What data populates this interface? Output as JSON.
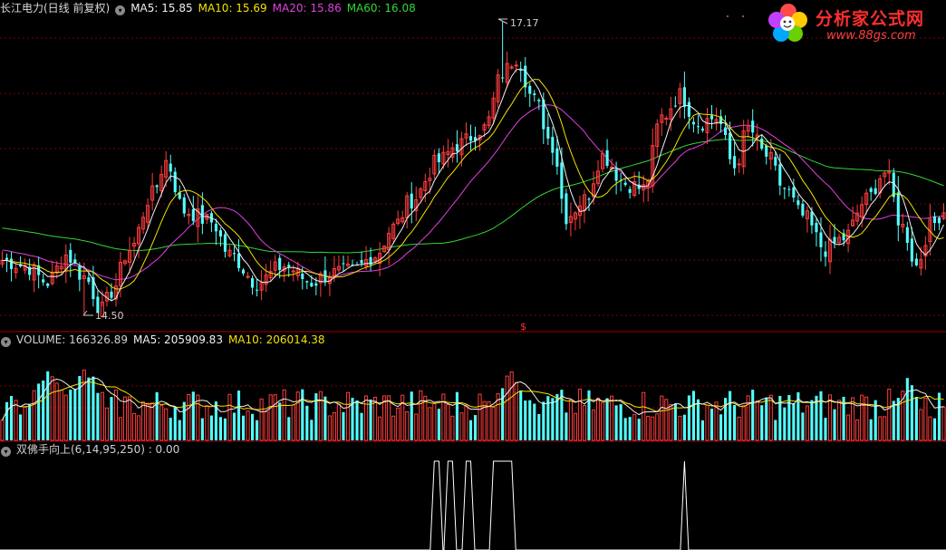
{
  "main": {
    "title": "长江电力(日线 前复权)",
    "ma": [
      {
        "label": "MA5: 15.85",
        "color": "#f0f0f0"
      },
      {
        "label": "MA10: 15.69",
        "color": "#f2e200"
      },
      {
        "label": "MA20: 15.86",
        "color": "#e040e0"
      },
      {
        "label": "MA60: 16.08",
        "color": "#33d633"
      }
    ],
    "high_label": "17.17",
    "low_label": "14.50",
    "marker": "$"
  },
  "volume": {
    "labels": [
      {
        "label": "VOLUME: 166326.89",
        "color": "#d0d0d0"
      },
      {
        "label": "MA5: 205909.83",
        "color": "#f0f0f0"
      },
      {
        "label": "MA10: 206014.38",
        "color": "#f2e200"
      }
    ]
  },
  "indicator": {
    "label": "双佛手向上(6,14,95,250) : 0.00",
    "color": "#d0d0d0"
  },
  "logo": {
    "text": "分析家公式网",
    "url": "www.88gs.com"
  },
  "colors": {
    "up": "#ff3d3d",
    "down": "#54ffff",
    "grid": "#7a0000",
    "separator": "#a00000"
  },
  "chart_data": {
    "type": "candlestick",
    "title": "长江电力(日线 前复权)",
    "price_range": [
      14.5,
      17.17
    ],
    "anchors": [
      {
        "i": 0,
        "c": 15.0
      },
      {
        "i": 5,
        "c": 14.95
      },
      {
        "i": 10,
        "c": 14.8
      },
      {
        "i": 14,
        "c": 15.05
      },
      {
        "i": 18,
        "c": 14.85
      },
      {
        "i": 22,
        "c": 14.55
      },
      {
        "i": 24,
        "c": 14.72
      },
      {
        "i": 28,
        "c": 15.1
      },
      {
        "i": 33,
        "c": 15.6
      },
      {
        "i": 36,
        "c": 15.9
      },
      {
        "i": 40,
        "c": 15.45
      },
      {
        "i": 46,
        "c": 15.35
      },
      {
        "i": 50,
        "c": 15.05
      },
      {
        "i": 56,
        "c": 14.8
      },
      {
        "i": 62,
        "c": 14.95
      },
      {
        "i": 68,
        "c": 14.8
      },
      {
        "i": 72,
        "c": 14.88
      },
      {
        "i": 77,
        "c": 14.9
      },
      {
        "i": 82,
        "c": 15.05
      },
      {
        "i": 86,
        "c": 15.3
      },
      {
        "i": 90,
        "c": 15.55
      },
      {
        "i": 96,
        "c": 15.9
      },
      {
        "i": 100,
        "c": 16.05
      },
      {
        "i": 106,
        "c": 16.2
      },
      {
        "i": 110,
        "c": 16.7
      },
      {
        "i": 113,
        "c": 16.85
      },
      {
        "i": 117,
        "c": 16.45
      },
      {
        "i": 121,
        "c": 16.05
      },
      {
        "i": 124,
        "c": 15.4
      },
      {
        "i": 128,
        "c": 15.55
      },
      {
        "i": 132,
        "c": 15.95
      },
      {
        "i": 137,
        "c": 15.7
      },
      {
        "i": 141,
        "c": 15.65
      },
      {
        "i": 145,
        "c": 16.3
      },
      {
        "i": 149,
        "c": 16.5
      },
      {
        "i": 153,
        "c": 16.25
      },
      {
        "i": 157,
        "c": 16.3
      },
      {
        "i": 161,
        "c": 15.85
      },
      {
        "i": 164,
        "c": 16.2
      },
      {
        "i": 168,
        "c": 15.95
      },
      {
        "i": 172,
        "c": 15.65
      },
      {
        "i": 176,
        "c": 15.4
      },
      {
        "i": 181,
        "c": 15.1
      },
      {
        "i": 185,
        "c": 15.2
      },
      {
        "i": 190,
        "c": 15.55
      },
      {
        "i": 194,
        "c": 15.8
      },
      {
        "i": 198,
        "c": 15.3
      },
      {
        "i": 201,
        "c": 14.95
      },
      {
        "i": 204,
        "c": 15.3
      },
      {
        "i": 207,
        "c": 15.45
      }
    ],
    "high_index": 110,
    "low_index": 18,
    "volume_peaks": [
      {
        "i": 10,
        "f": 1.0
      },
      {
        "i": 18,
        "f": 1.0
      },
      {
        "i": 112,
        "f": 0.92
      },
      {
        "i": 199,
        "f": 0.7
      }
    ],
    "indicator_pulses": [
      {
        "start": 95,
        "end": 96
      },
      {
        "start": 98,
        "end": 99
      },
      {
        "start": 102,
        "end": 103
      },
      {
        "start": 108,
        "end": 112
      },
      {
        "start": 150,
        "end": 150
      }
    ]
  }
}
